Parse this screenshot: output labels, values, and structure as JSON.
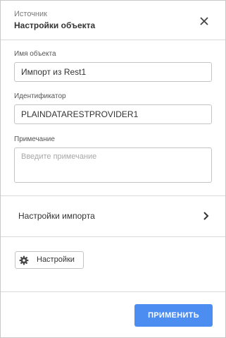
{
  "header": {
    "subtitle": "Источник",
    "title": "Настройки объекта",
    "close_icon": "close-icon"
  },
  "fields": {
    "object_name": {
      "label": "Имя объекта",
      "value": "Импорт из Rest1"
    },
    "identifier": {
      "label": "Идентификатор",
      "value": "PLAINDATARESTPROVIDER1"
    },
    "note": {
      "label": "Примечание",
      "value": "",
      "placeholder": "Введите примечание"
    }
  },
  "import_settings": {
    "label": "Настройки импорта",
    "icon": "chevron-right-icon"
  },
  "settings_button": {
    "label": "Настройки",
    "icon": "gear-icon"
  },
  "apply_button": {
    "label": "ПРИМЕНИТЬ"
  },
  "colors": {
    "accent": "#4c8df2",
    "border": "#c4c4c4",
    "divider": "#d9d9d9"
  }
}
